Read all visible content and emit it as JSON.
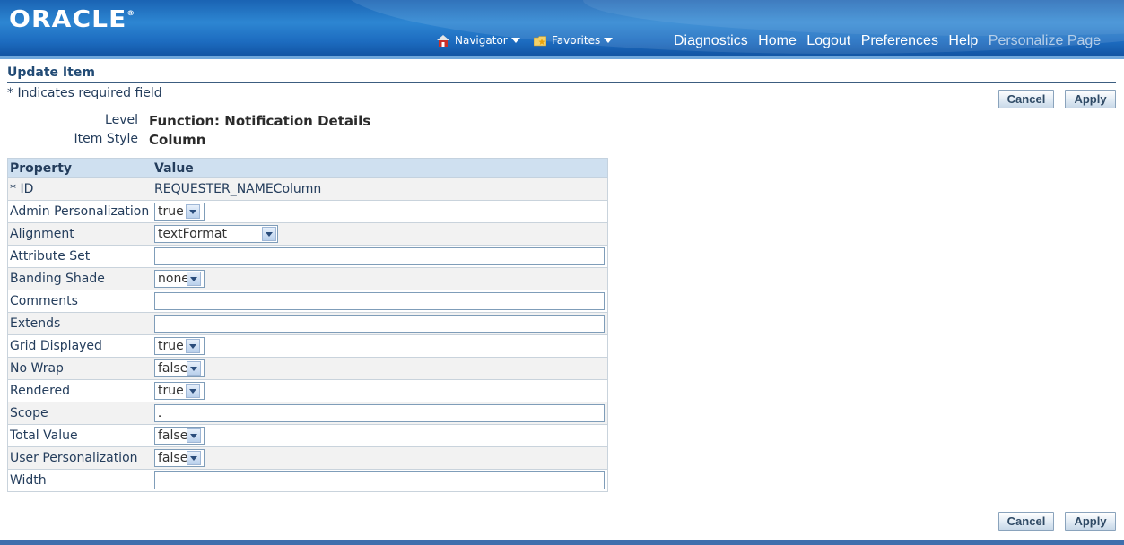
{
  "header": {
    "logo": "ORACLE",
    "logo_mark": "®",
    "navigator_label": "Navigator",
    "favorites_label": "Favorites",
    "links": {
      "diagnostics": "Diagnostics",
      "home": "Home",
      "logout": "Logout",
      "preferences": "Preferences",
      "help": "Help",
      "personalize": "Personalize Page"
    }
  },
  "page": {
    "title": "Update Item",
    "required_note": "* Indicates required field",
    "cancel_label": "Cancel",
    "apply_label": "Apply"
  },
  "info": {
    "level_label": "Level",
    "level_value": "Function: Notification Details",
    "style_label": "Item Style",
    "style_value": "Column"
  },
  "table": {
    "col_property": "Property",
    "col_value": "Value",
    "rows": {
      "id": {
        "name": "* ID",
        "value": "REQUESTER_NAMEColumn"
      },
      "admin": {
        "name": "Admin Personalization",
        "value": "true"
      },
      "alignment": {
        "name": "Alignment",
        "value": "textFormat"
      },
      "attribute_set": {
        "name": "Attribute Set",
        "value": ""
      },
      "banding": {
        "name": "Banding Shade",
        "value": "none"
      },
      "comments": {
        "name": "Comments",
        "value": ""
      },
      "extends": {
        "name": "Extends",
        "value": ""
      },
      "grid": {
        "name": "Grid Displayed",
        "value": "true"
      },
      "nowrap": {
        "name": "No Wrap",
        "value": "false"
      },
      "rendered": {
        "name": "Rendered",
        "value": "true"
      },
      "scope": {
        "name": "Scope",
        "value": "."
      },
      "total": {
        "name": "Total Value",
        "value": "false"
      },
      "userpers": {
        "name": "User Personalization",
        "value": "false"
      },
      "width": {
        "name": "Width",
        "value": ""
      }
    }
  }
}
